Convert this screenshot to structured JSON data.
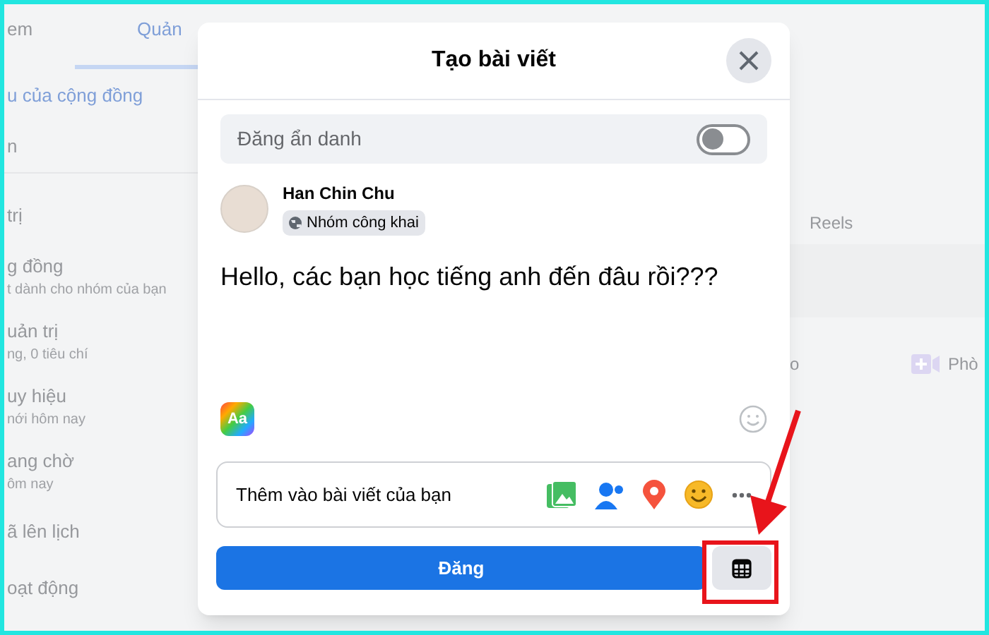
{
  "background": {
    "tabs": [
      {
        "label": "em",
        "selected": false
      },
      {
        "label": "Quản",
        "selected": true
      }
    ],
    "sidebar_items": [
      {
        "title": "u của cộng đồng",
        "kind": "link"
      },
      {
        "title": "n",
        "kind": "plain"
      },
      {
        "title": "trị",
        "kind": "plain"
      },
      {
        "title": "g đồng",
        "subtitle": "t dành cho nhóm của bạn",
        "kind": "plain"
      },
      {
        "title": "uản trị",
        "subtitle": "ng, 0 tiêu chí",
        "kind": "plain"
      },
      {
        "title": "uy hiệu",
        "subtitle": "nới hôm nay",
        "kind": "plain"
      },
      {
        "title": "ang chờ",
        "subtitle": "ôm nay",
        "kind": "plain"
      },
      {
        "title": "ã lên lịch",
        "kind": "plain"
      },
      {
        "title": "oạt động",
        "kind": "plain"
      }
    ],
    "feed_tab": "Reels",
    "feed_actions": [
      "o",
      "Phò"
    ]
  },
  "dialog": {
    "title": "Tạo bài viết",
    "anonymous": {
      "label": "Đăng ẩn danh",
      "on": false
    },
    "author": {
      "name": "Han Chin Chu",
      "audience": "Nhóm công khai"
    },
    "post_text": "Hello, các bạn học tiếng anh đến đâu rồi???",
    "text_style_button": "Aa",
    "add_to_post": "Thêm vào bài viết của bạn",
    "post_button": "Đăng"
  }
}
